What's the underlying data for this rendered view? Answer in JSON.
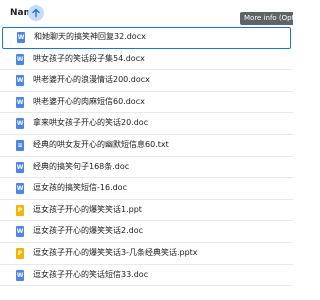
{
  "header": {
    "name_label": "Name",
    "sort_icon": "arrow-up-icon",
    "tooltip": "More info (Option"
  },
  "files": [
    {
      "name": "和她聊天的搞笑神回复32.docx",
      "type": "word",
      "icon": "W",
      "selected": true
    },
    {
      "name": "哄女孩子的笑话段子集54.docx",
      "type": "word",
      "icon": "W"
    },
    {
      "name": "哄老婆开心的浪漫情话200.docx",
      "type": "word",
      "icon": "W"
    },
    {
      "name": "哄老婆开心的肉麻短信60.docx",
      "type": "word",
      "icon": "W"
    },
    {
      "name": "拿来哄女孩子开心的笑话20.doc",
      "type": "word",
      "icon": "W"
    },
    {
      "name": "经典的哄女友开心的幽默短信息60.txt",
      "type": "txt",
      "icon": "≡"
    },
    {
      "name": "经典的搞笑句子168条.doc",
      "type": "word",
      "icon": "W"
    },
    {
      "name": "逗女孩的搞笑短信-16.doc",
      "type": "word",
      "icon": "W"
    },
    {
      "name": "逗女孩子开心的爆笑笑话1.ppt",
      "type": "ppt",
      "icon": "P"
    },
    {
      "name": "逗女孩子开心的爆笑笑话2.doc",
      "type": "word",
      "icon": "W"
    },
    {
      "name": "逗女孩子开心的爆笑笑话3-几条经典笑话.pptx",
      "type": "ppt",
      "icon": "P"
    },
    {
      "name": "逗女孩子开心的笑话短信33.doc",
      "type": "word",
      "icon": "W"
    }
  ]
}
